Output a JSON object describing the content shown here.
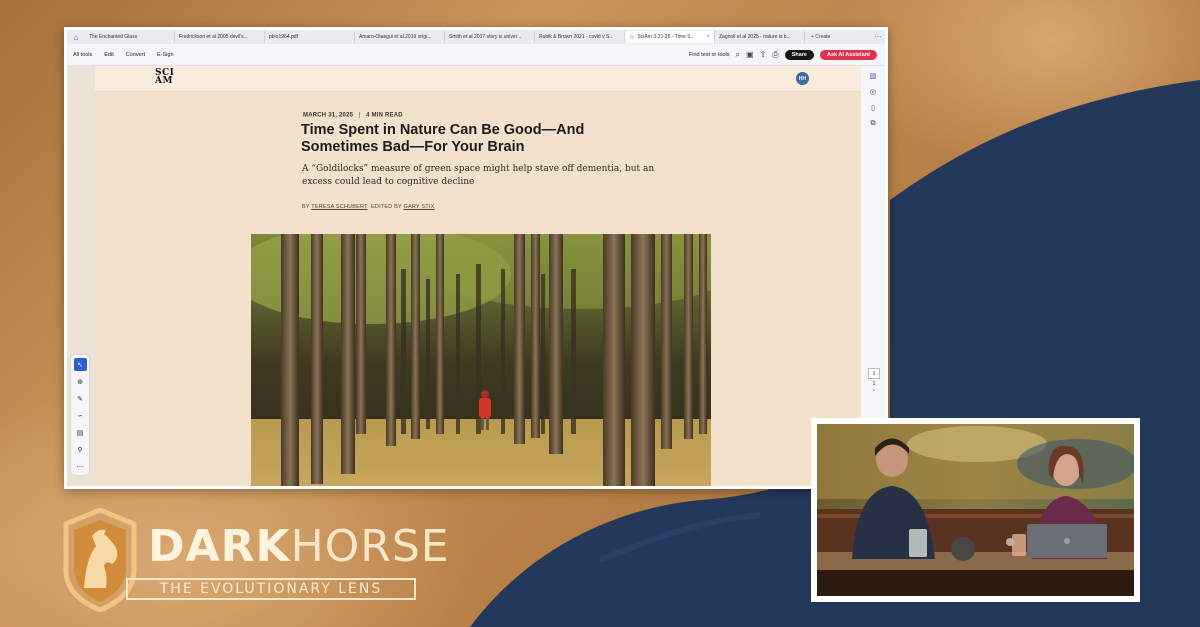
{
  "browser": {
    "tabs": [
      {
        "label": "The Enchanted Glass",
        "active": false
      },
      {
        "label": "Fredrickson et al 2005 devil's...",
        "active": false
      },
      {
        "label": "pbio1964.pdf",
        "active": false
      },
      {
        "label": "Amaro-Otaegui et al 2019 origi...",
        "active": false
      },
      {
        "label": "Smith et al 2017 story is univer...",
        "active": false
      },
      {
        "label": "Rubik & Brown 2021 - covid v S...",
        "active": false
      },
      {
        "label": "SciAm 3-31-25 - Time S...",
        "active": true
      },
      {
        "label": "Zagnoli et al 2025 - nature is b...",
        "active": false
      }
    ],
    "create_tab_label": "+ Create",
    "toolbar": {
      "items": [
        "All tools",
        "Edit",
        "Convert",
        "E-Sign"
      ],
      "find_label": "Find text or tools",
      "share_label": "Share",
      "ai_label": "Ask AI Assistant"
    }
  },
  "article": {
    "logo_line1": "SCI",
    "logo_line2": "AM",
    "avatar_initials": "HH",
    "date": "MARCH 31, 2025",
    "read_time": "4 MIN READ",
    "headline": "Time Spent in Nature Can Be Good—And Sometimes Bad—For Your Brain",
    "dek": "A “Goldilocks” measure of green space might help stave off dementia, but an excess could lead to cognitive decline",
    "byline_prefix": "BY",
    "author": "TERESA SCHUBERT",
    "edited_prefix": "EDITED BY",
    "editor": "GARY STIX"
  },
  "page_nav": {
    "current_page": "1",
    "total_pages": "1"
  },
  "brand": {
    "name_bold": "DARK",
    "name_light": "HORSE",
    "subtitle": "THE EVOLUTIONARY LENS"
  },
  "colors": {
    "sand": "#c08a4e",
    "navy": "#23375a",
    "page_bg": "#f2e2cc",
    "ai_button": "#e0324e",
    "brand_cream": "#f7e7c8"
  }
}
